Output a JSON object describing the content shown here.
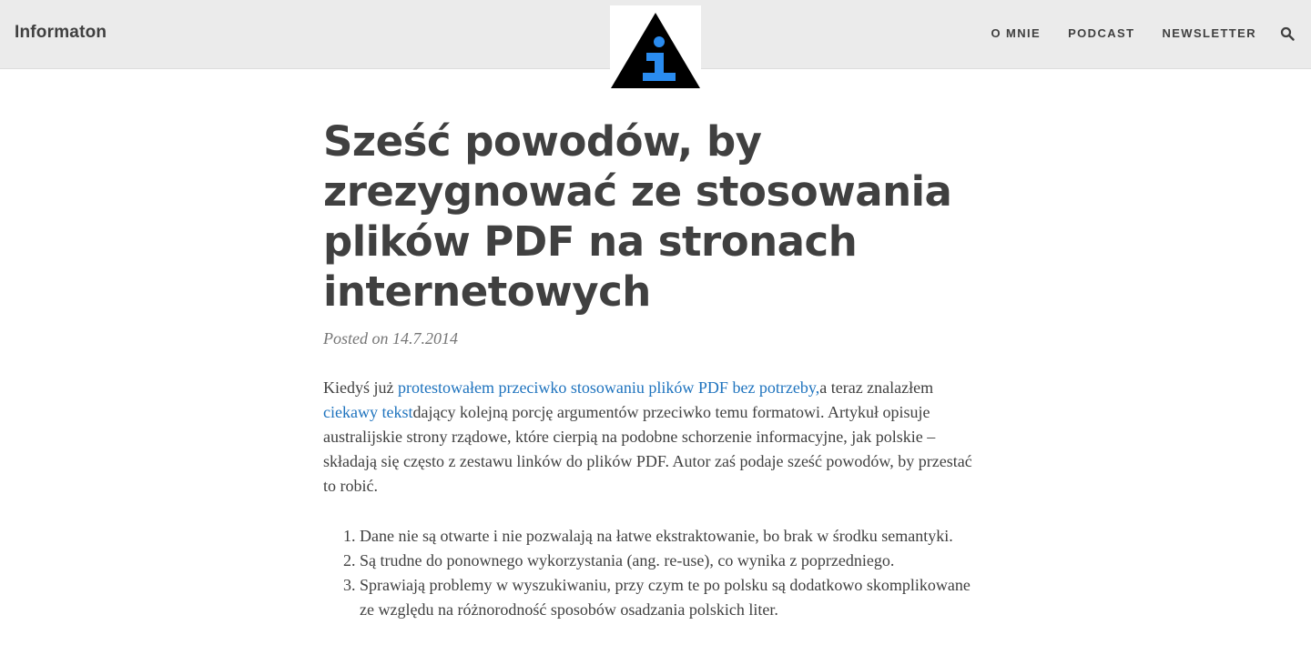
{
  "header": {
    "site_title": "Informaton",
    "nav": [
      {
        "label": "O MNIE"
      },
      {
        "label": "PODCAST"
      },
      {
        "label": "NEWSLETTER"
      }
    ],
    "logo_letter": "i"
  },
  "colors": {
    "link": "#1e73be",
    "logo_blue": "#2a8cf0",
    "topbar": "#ebebeb"
  },
  "article": {
    "title": "Sześć powodów, by zrezygnować ze stosowania plików PDF na stronach internetowych",
    "meta": "Posted on 14.7.2014",
    "intro": {
      "t1": "Kiedyś już ",
      "link1": "protestowałem przeciwko stosowaniu plików PDF bez potrzeby,",
      "t2": "a teraz znalazłem ",
      "link2": "ciekawy tekst",
      "t3": "dający kolejną porcję argumentów przeciwko temu formatowi. Artykuł opisuje australijskie strony rządowe, które cierpią na podobne schorzenie informacyjne, jak polskie – składają się często z zestawu linków do plików PDF. Autor zaś podaje sześć powodów, by przestać to robić."
    },
    "reasons": [
      "Dane nie są otwarte i nie pozwalają na łatwe ekstraktowanie, bo brak w środku semantyki.",
      "Są trudne do ponownego wykorzystania (ang. re-use), co wynika z poprzedniego.",
      "Sprawiają problemy w wyszukiwaniu, przy czym te po polsku są dodatkowo skomplikowane ze względu na różnorodność sposobów osadzania polskich liter."
    ]
  }
}
